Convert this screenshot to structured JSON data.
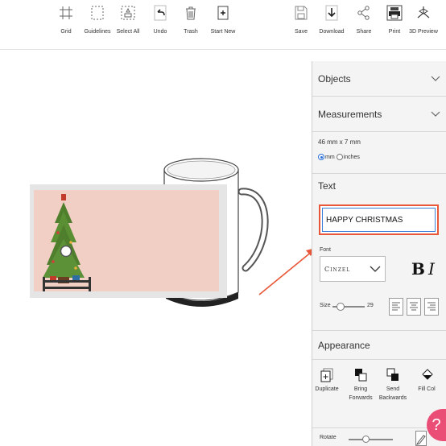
{
  "toolbar": {
    "items": [
      {
        "label": "Grid",
        "icon": "grid-icon"
      },
      {
        "label": "Guidelines",
        "icon": "guidelines-icon"
      },
      {
        "label": "Select All",
        "icon": "select-all-icon"
      },
      {
        "label": "Undo",
        "icon": "undo-icon"
      },
      {
        "label": "Trash",
        "icon": "trash-icon"
      },
      {
        "label": "Start New",
        "icon": "start-new-icon"
      },
      {
        "label": "Save",
        "icon": "save-icon"
      },
      {
        "label": "Download",
        "icon": "download-icon"
      },
      {
        "label": "Share",
        "icon": "share-icon"
      },
      {
        "label": "Print",
        "icon": "print-icon"
      },
      {
        "label": "3D Preview",
        "icon": "3d-preview-icon"
      }
    ]
  },
  "panel": {
    "objects_label": "Objects",
    "measurements_label": "Measurements",
    "dimensions": "46 mm x 7 mm",
    "unit_mm": "mm",
    "unit_inches": "inches",
    "selected_unit": "mm",
    "text_label": "Text",
    "text_value": "HAPPY CHRISTMAS",
    "font_label": "Font",
    "font_value": "Cinzel",
    "bold_label": "B",
    "italic_label": "I",
    "size_label": "Size",
    "size_value": "29",
    "appearance_label": "Appearance",
    "actions": [
      {
        "label": "Duplicate",
        "icon": "duplicate-icon"
      },
      {
        "label": "Bring Forwards",
        "icon": "bring-forwards-icon"
      },
      {
        "label": "Send Backwards",
        "icon": "send-backwards-icon"
      },
      {
        "label": "Fill Col",
        "icon": "fill-color-icon"
      }
    ],
    "rotate_label": "Rotate"
  },
  "help": {
    "label": "?"
  },
  "colors": {
    "highlight": "#e8573a",
    "design_background": "#f2cfc4",
    "help_button": "#ea4d76",
    "accent": "#2a6fd6"
  }
}
